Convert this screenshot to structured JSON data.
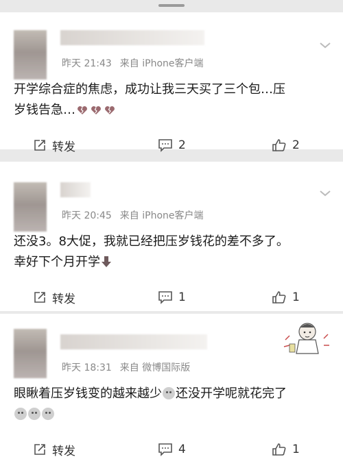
{
  "posts": [
    {
      "meta_time": "昨天 21:43",
      "meta_source": "来自 iPhone客户端",
      "content_lines": [
        "开学综合症的焦虑，成功让我三天买了三个包…压",
        "岁钱告急…"
      ],
      "repost_label": "转发",
      "comment_count": "2",
      "like_count": "2",
      "icons": [
        "broken-heart-icon",
        "broken-heart-icon",
        "broken-heart-icon"
      ]
    },
    {
      "meta_time": "昨天 20:45",
      "meta_source": "来自 iPhone客户端",
      "content_lines": [
        "还没3。8大促，我就已经把压岁钱花的差不多了。",
        "幸好下个月开学"
      ],
      "repost_label": "转发",
      "comment_count": "1",
      "like_count": "1",
      "icons": [
        "down-arrow-emoji-icon"
      ]
    },
    {
      "meta_time": "昨天 18:31",
      "meta_source": "来自 微博国际版",
      "content_lines": [
        "眼瞅着压岁钱变的越来越少",
        "还没开学呢就花完了"
      ],
      "repost_label": "转发",
      "comment_count": "4",
      "like_count": "1",
      "icons": [
        "sad-face-emoji-icon",
        "sad-face-emoji-icon",
        "sad-face-emoji-icon",
        "sad-face-emoji-icon"
      ]
    }
  ],
  "colors": {
    "background": "#e9e9e9",
    "card": "#ffffff",
    "meta_text": "#888888",
    "broken_heart": "#9b6a6f"
  }
}
